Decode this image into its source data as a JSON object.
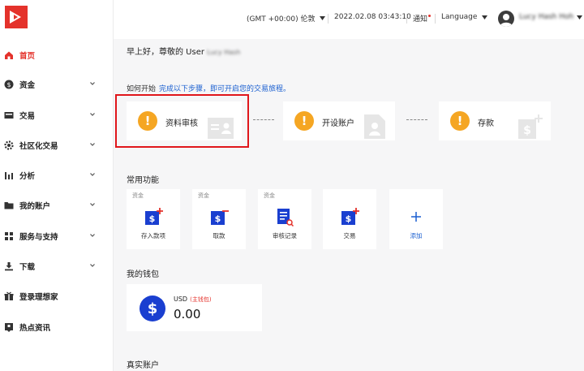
{
  "header": {
    "timezone": "(GMT +00:00) 伦敦",
    "datetime": "2022.02.08 03:43:10",
    "notifications": "通知",
    "language": "Language",
    "username": "Lucy Hash Hoh"
  },
  "sidebar": {
    "items": [
      {
        "label": "首页",
        "icon": "home-icon"
      },
      {
        "label": "资金",
        "icon": "dollar-icon"
      },
      {
        "label": "交易",
        "icon": "card-icon"
      },
      {
        "label": "社区化交易",
        "icon": "gear-icon"
      },
      {
        "label": "分析",
        "icon": "bar-chart-icon"
      },
      {
        "label": "我的账户",
        "icon": "folder-icon"
      },
      {
        "label": "服务与支持",
        "icon": "grid-icon"
      },
      {
        "label": "下载",
        "icon": "download-icon"
      },
      {
        "label": "登录理想家",
        "icon": "gift-icon"
      },
      {
        "label": "热点资讯",
        "icon": "news-icon"
      }
    ]
  },
  "main": {
    "greeting": "早上好，尊敬的 User",
    "greeting_name": "Lucy Hash",
    "howto_label": "如何开始",
    "howto_link": "完成以下步骤，即可开启您的交易旅程。",
    "steps": [
      {
        "label": "资料审核"
      },
      {
        "label": "开设账户"
      },
      {
        "label": "存款"
      }
    ],
    "functions_title": "常用功能",
    "functions": [
      {
        "tag": "资金",
        "label": "存入款项",
        "icon": "deposit-icon"
      },
      {
        "tag": "资金",
        "label": "取款",
        "icon": "withdraw-icon"
      },
      {
        "tag": "资金",
        "label": "审核记录",
        "icon": "review-record-icon"
      },
      {
        "tag": "",
        "label": "交易",
        "icon": "transaction-icon"
      },
      {
        "tag": "",
        "label": "添加",
        "icon": "add-icon"
      }
    ],
    "wallet_title": "我的钱包",
    "wallet": {
      "currency": "USD",
      "tag": "(主钱包)",
      "amount": "0.00"
    },
    "real_accounts_title": "真实账户"
  },
  "colors": {
    "accent": "#e4322b",
    "link": "#1a5fd0",
    "warning": "#f5a623",
    "wallet_blue": "#1a3fd0"
  }
}
